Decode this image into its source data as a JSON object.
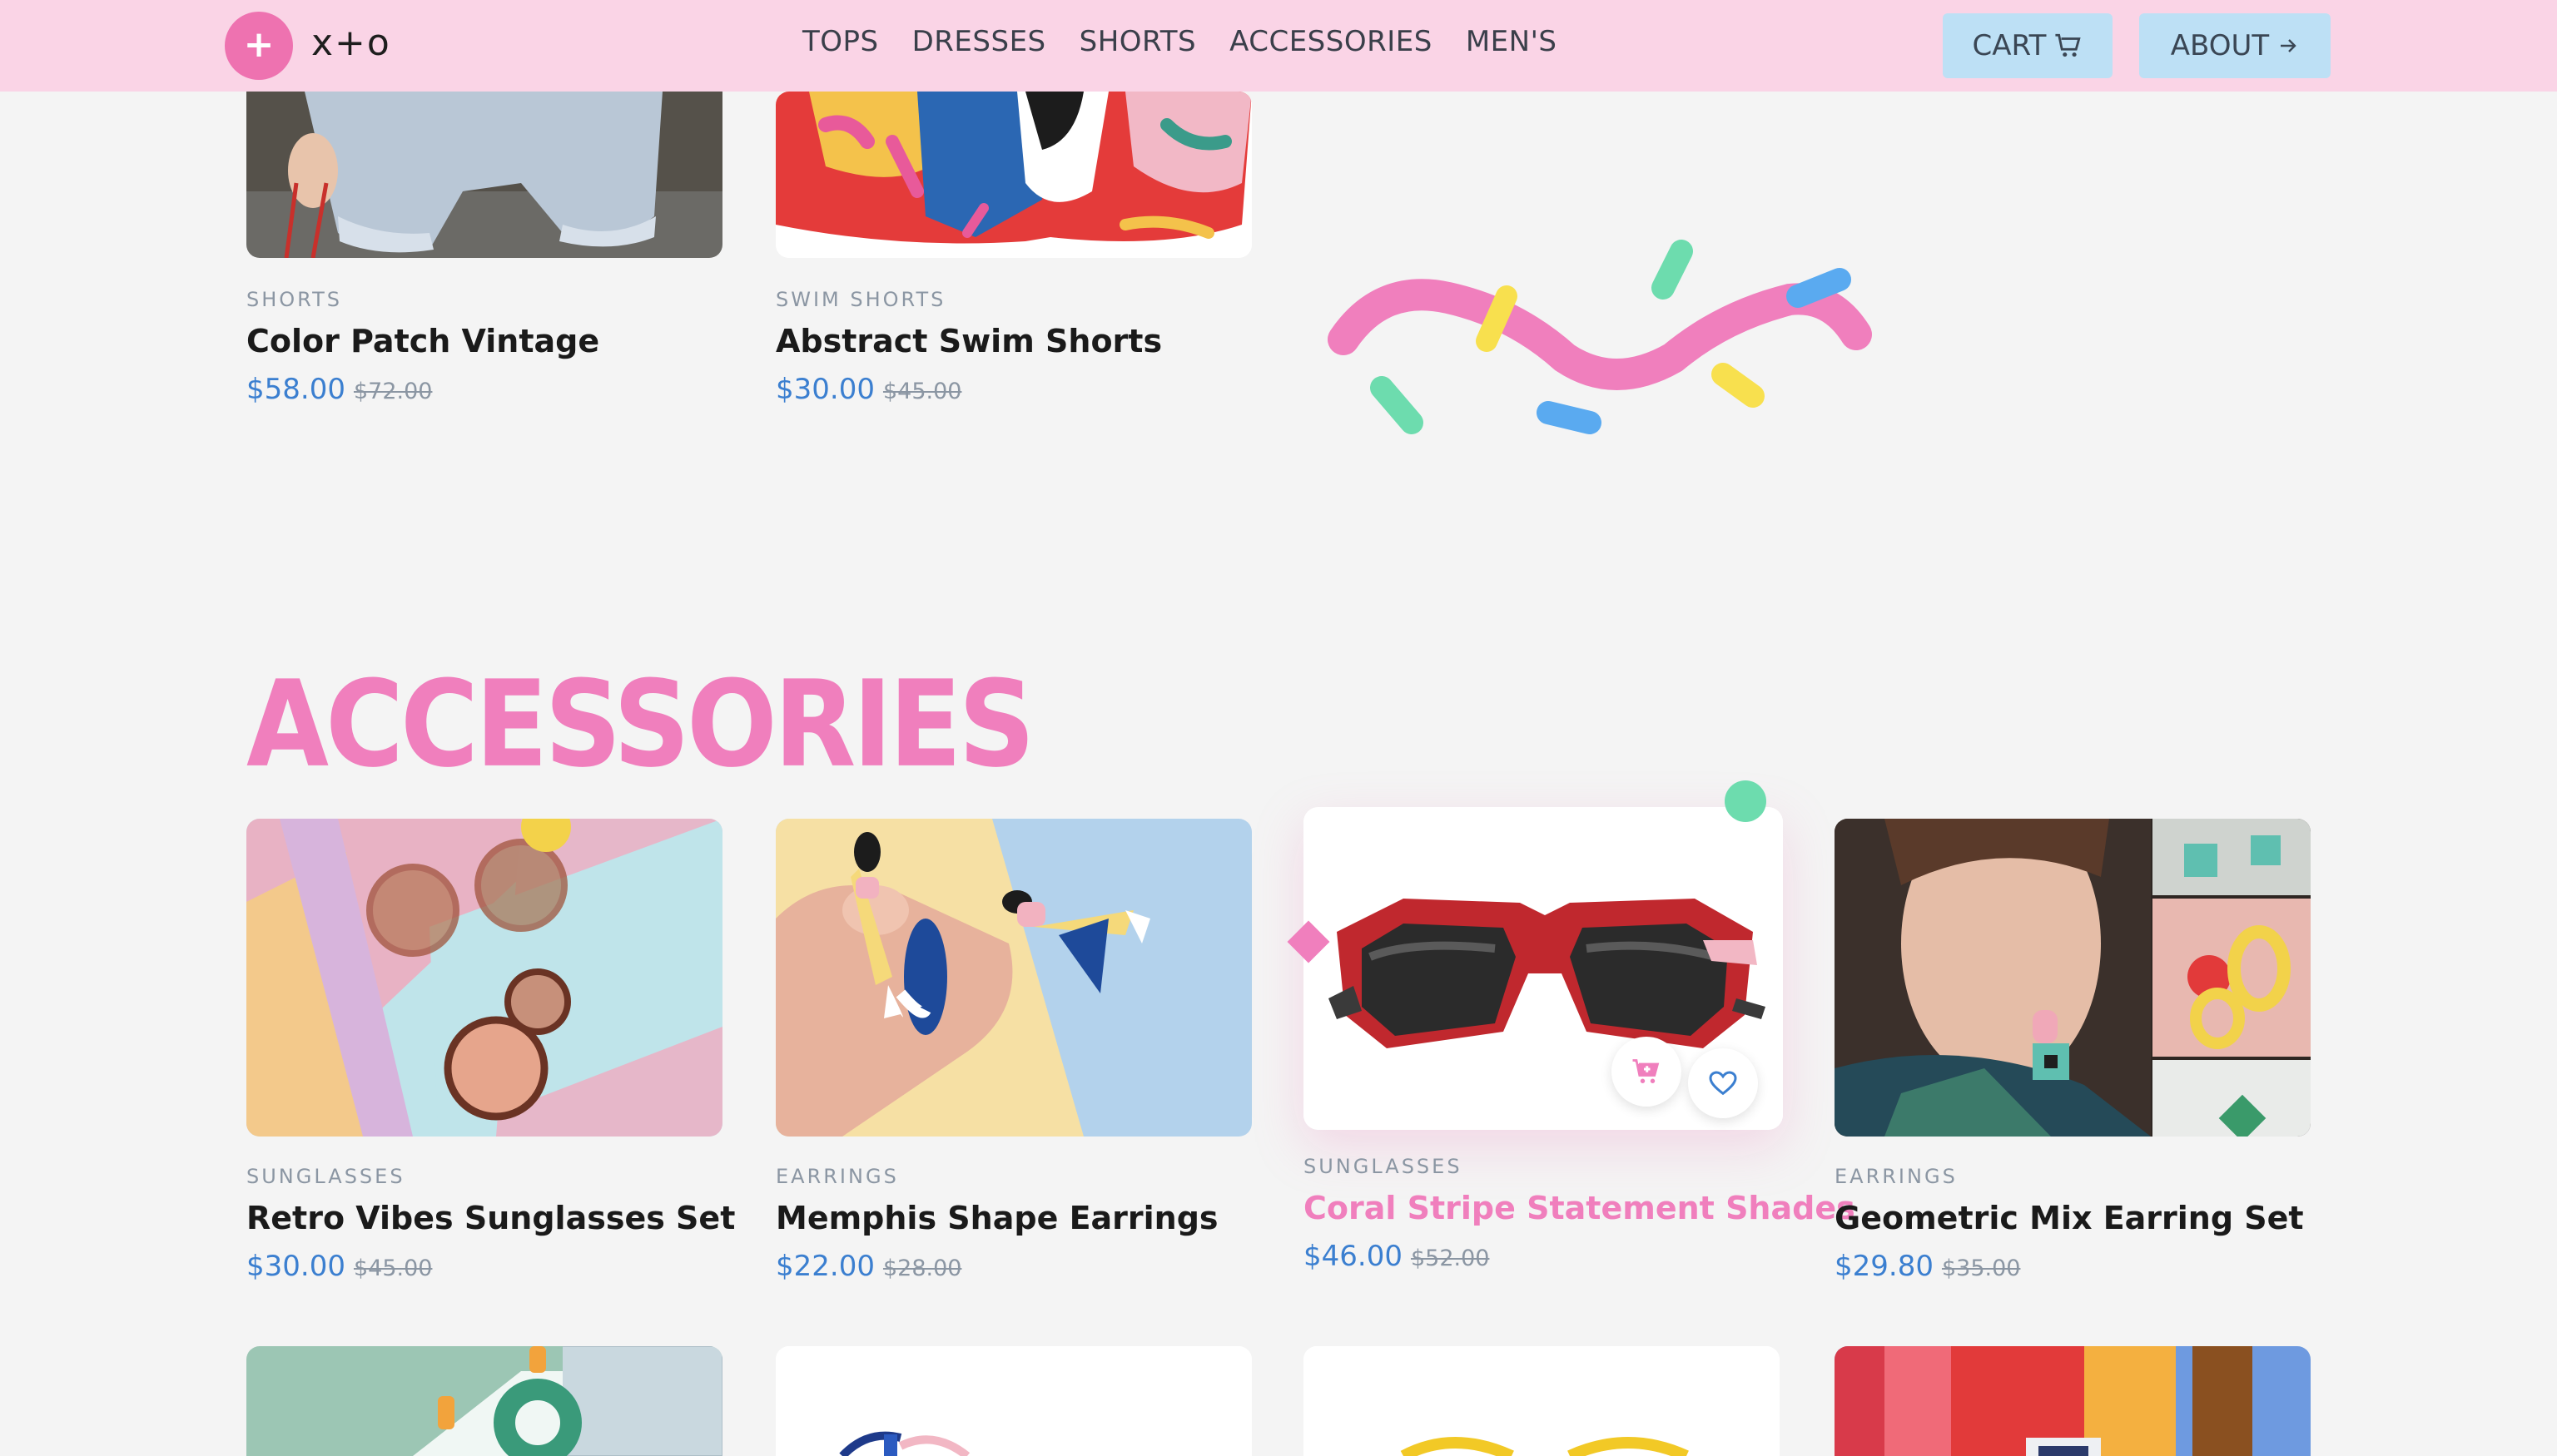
{
  "header": {
    "logo_symbol": "+",
    "logo_text": "x+o",
    "nav": [
      "TOPS",
      "DRESSES",
      "SHORTS",
      "ACCESSORIES",
      "MEN'S"
    ],
    "cart_label": "CART",
    "about_label": "ABOUT",
    "cart_icon": "cart-icon",
    "about_icon": "arrow-right-icon"
  },
  "shorts_row": [
    {
      "category": "SHORTS",
      "name": "Color Patch Vintage",
      "price": "$58.00",
      "original_price": "$72.00"
    },
    {
      "category": "SWIM SHORTS",
      "name": "Abstract Swim Shorts",
      "price": "$30.00",
      "original_price": "$45.00"
    }
  ],
  "accessories": {
    "title": "ACCESSORIES",
    "products": [
      {
        "category": "SUNGLASSES",
        "name": "Retro Vibes Sunglasses Set",
        "price": "$30.00",
        "original_price": "$45.00"
      },
      {
        "category": "EARRINGS",
        "name": "Memphis Shape Earrings",
        "price": "$22.00",
        "original_price": "$28.00"
      },
      {
        "category": "SUNGLASSES",
        "name": "Coral Stripe Statement Shades",
        "price": "$46.00",
        "original_price": "$52.00",
        "highlighted": true
      },
      {
        "category": "EARRINGS",
        "name": "Geometric Mix Earring Set",
        "price": "$29.80",
        "original_price": "$35.00"
      }
    ]
  },
  "colors": {
    "header_bg": "#fad4e6",
    "accent_pink": "#f07fbd",
    "price_blue": "#3b7fd0",
    "button_blue": "#bde0f5"
  }
}
